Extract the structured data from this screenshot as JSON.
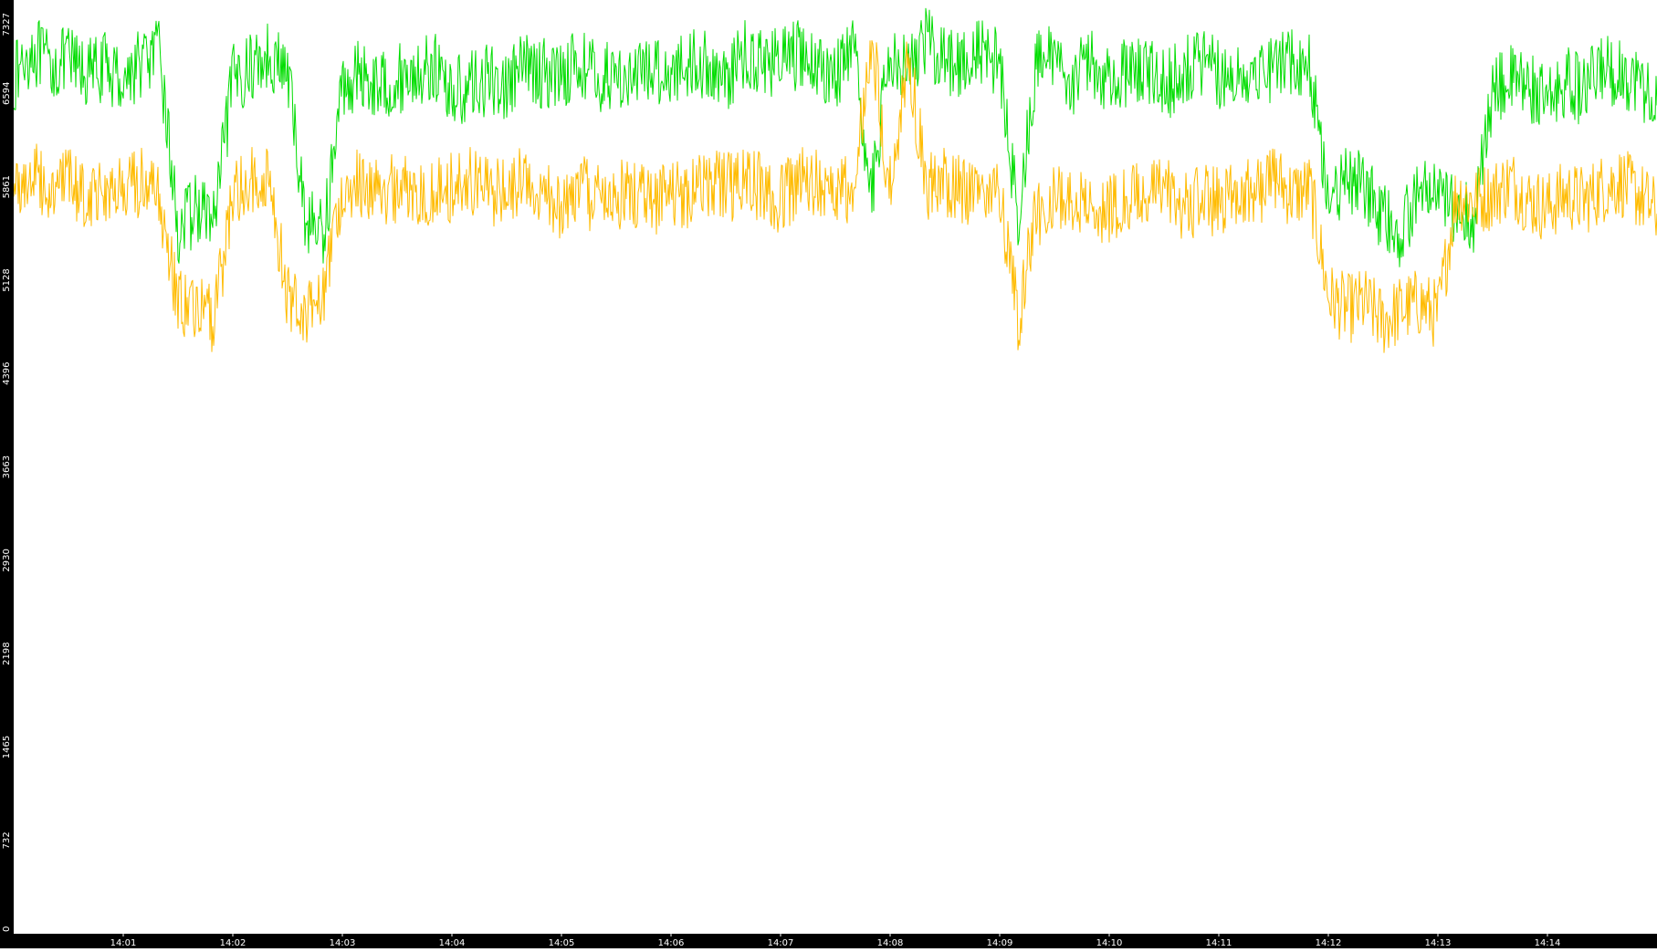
{
  "chart_data": {
    "type": "line",
    "title": "",
    "xlabel": "",
    "ylabel": "",
    "background": "#ffffff",
    "axis_color": "#000000",
    "tick_label_color": "#ffffff",
    "grid": false,
    "legend": "none",
    "ylim": [
      0,
      7327
    ],
    "y_ticks": [
      0,
      732,
      1465,
      2198,
      2930,
      3663,
      4396,
      5128,
      5861,
      6594,
      7327
    ],
    "y_tick_labels": [
      "0",
      "732",
      "1465",
      "2198",
      "2930",
      "3663",
      "4396",
      "5128",
      "5861",
      "6594",
      "7327"
    ],
    "x_unit": "time",
    "xlim": [
      "14:00:00",
      "14:15:00"
    ],
    "x_ticks": [
      "14:01",
      "14:02",
      "14:03",
      "14:04",
      "14:05",
      "14:06",
      "14:07",
      "14:08",
      "14:09",
      "14:10",
      "14:11",
      "14:12",
      "14:13",
      "14:14"
    ],
    "series": [
      {
        "color": "#00dd00",
        "x": [
          "14:00:00",
          "14:00:10",
          "14:00:20",
          "14:00:30",
          "14:00:40",
          "14:00:50",
          "14:01:00",
          "14:01:10",
          "14:01:20",
          "14:01:30",
          "14:01:40",
          "14:01:50",
          "14:02:00",
          "14:02:10",
          "14:02:20",
          "14:02:30",
          "14:02:40",
          "14:02:50",
          "14:03:00",
          "14:03:10",
          "14:03:20",
          "14:03:30",
          "14:03:40",
          "14:03:50",
          "14:04:00",
          "14:04:10",
          "14:04:20",
          "14:04:30",
          "14:04:40",
          "14:04:50",
          "14:05:00",
          "14:05:10",
          "14:05:20",
          "14:05:30",
          "14:05:40",
          "14:05:50",
          "14:06:00",
          "14:06:10",
          "14:06:20",
          "14:06:30",
          "14:06:40",
          "14:06:50",
          "14:07:00",
          "14:07:10",
          "14:07:20",
          "14:07:30",
          "14:07:40",
          "14:07:50",
          "14:08:00",
          "14:08:10",
          "14:08:20",
          "14:08:30",
          "14:08:40",
          "14:08:50",
          "14:09:00",
          "14:09:10",
          "14:09:20",
          "14:09:30",
          "14:09:40",
          "14:09:50",
          "14:10:00",
          "14:10:10",
          "14:10:20",
          "14:10:30",
          "14:10:40",
          "14:10:50",
          "14:11:00",
          "14:11:10",
          "14:11:20",
          "14:11:30",
          "14:11:40",
          "14:11:50",
          "14:12:00",
          "14:12:10",
          "14:12:20",
          "14:12:30",
          "14:12:40",
          "14:12:50",
          "14:13:00",
          "14:13:10",
          "14:13:20",
          "14:13:30",
          "14:13:40",
          "14:13:50",
          "14:14:00",
          "14:14:10",
          "14:14:20",
          "14:14:30",
          "14:14:40",
          "14:14:50",
          "14:15:00"
        ],
        "values": [
          6700,
          6950,
          6800,
          6850,
          6750,
          6800,
          6700,
          6850,
          6900,
          5500,
          5700,
          5600,
          6700,
          6800,
          6900,
          6750,
          5600,
          5500,
          6650,
          6750,
          6650,
          6700,
          6750,
          6800,
          6600,
          6650,
          6700,
          6650,
          6800,
          6750,
          6750,
          6850,
          6700,
          6750,
          6700,
          6800,
          6750,
          6850,
          6800,
          6700,
          6900,
          6850,
          6850,
          6900,
          6800,
          6750,
          6900,
          5800,
          6950,
          6800,
          7000,
          6850,
          6850,
          6900,
          6850,
          5600,
          6800,
          6900,
          6700,
          6850,
          6700,
          6750,
          6800,
          6650,
          6750,
          6850,
          6750,
          6700,
          6800,
          6800,
          6850,
          6800,
          5800,
          5900,
          5850,
          5600,
          5500,
          5850,
          5750,
          5700,
          5600,
          6600,
          6700,
          6650,
          6500,
          6700,
          6600,
          6800,
          6750,
          6700,
          6500
        ]
      },
      {
        "color": "#ffbb00",
        "x": [
          "14:00:00",
          "14:00:10",
          "14:00:20",
          "14:00:30",
          "14:00:40",
          "14:00:50",
          "14:01:00",
          "14:01:10",
          "14:01:20",
          "14:01:30",
          "14:01:40",
          "14:01:50",
          "14:02:00",
          "14:02:10",
          "14:02:20",
          "14:02:30",
          "14:02:40",
          "14:02:50",
          "14:03:00",
          "14:03:10",
          "14:03:20",
          "14:03:30",
          "14:03:40",
          "14:03:50",
          "14:04:00",
          "14:04:10",
          "14:04:20",
          "14:04:30",
          "14:04:40",
          "14:04:50",
          "14:05:00",
          "14:05:10",
          "14:05:20",
          "14:05:30",
          "14:05:40",
          "14:05:50",
          "14:06:00",
          "14:06:10",
          "14:06:20",
          "14:06:30",
          "14:06:40",
          "14:06:50",
          "14:07:00",
          "14:07:10",
          "14:07:20",
          "14:07:30",
          "14:07:40",
          "14:07:50",
          "14:08:00",
          "14:08:10",
          "14:08:20",
          "14:08:30",
          "14:08:40",
          "14:08:50",
          "14:09:00",
          "14:09:10",
          "14:09:20",
          "14:09:30",
          "14:09:40",
          "14:09:50",
          "14:10:00",
          "14:10:10",
          "14:10:20",
          "14:10:30",
          "14:10:40",
          "14:10:50",
          "14:11:00",
          "14:11:10",
          "14:11:20",
          "14:11:30",
          "14:11:40",
          "14:11:50",
          "14:12:00",
          "14:12:10",
          "14:12:20",
          "14:12:30",
          "14:12:40",
          "14:12:50",
          "14:13:00",
          "14:13:10",
          "14:13:20",
          "14:13:30",
          "14:13:40",
          "14:13:50",
          "14:14:00",
          "14:14:10",
          "14:14:20",
          "14:14:30",
          "14:14:40",
          "14:14:50",
          "14:15:00"
        ],
        "values": [
          5850,
          5950,
          5850,
          5900,
          5800,
          5850,
          5800,
          5900,
          5750,
          4950,
          4900,
          4800,
          5850,
          5900,
          5950,
          5000,
          4900,
          5050,
          5850,
          5900,
          5800,
          5850,
          5850,
          5800,
          5850,
          5900,
          5800,
          5850,
          5900,
          5800,
          5700,
          5850,
          5750,
          5800,
          5800,
          5750,
          5850,
          5800,
          5900,
          5850,
          5900,
          5850,
          5750,
          5900,
          5900,
          5850,
          5800,
          7000,
          5850,
          6900,
          5850,
          5900,
          5850,
          5800,
          5850,
          4800,
          5650,
          5750,
          5800,
          5700,
          5700,
          5750,
          5800,
          5850,
          5700,
          5750,
          5750,
          5850,
          5800,
          5950,
          5800,
          5850,
          5000,
          4900,
          4950,
          4800,
          4900,
          4950,
          4850,
          5800,
          5750,
          5800,
          5900,
          5750,
          5700,
          5800,
          5750,
          5850,
          5900,
          5800,
          5650
        ]
      }
    ]
  }
}
